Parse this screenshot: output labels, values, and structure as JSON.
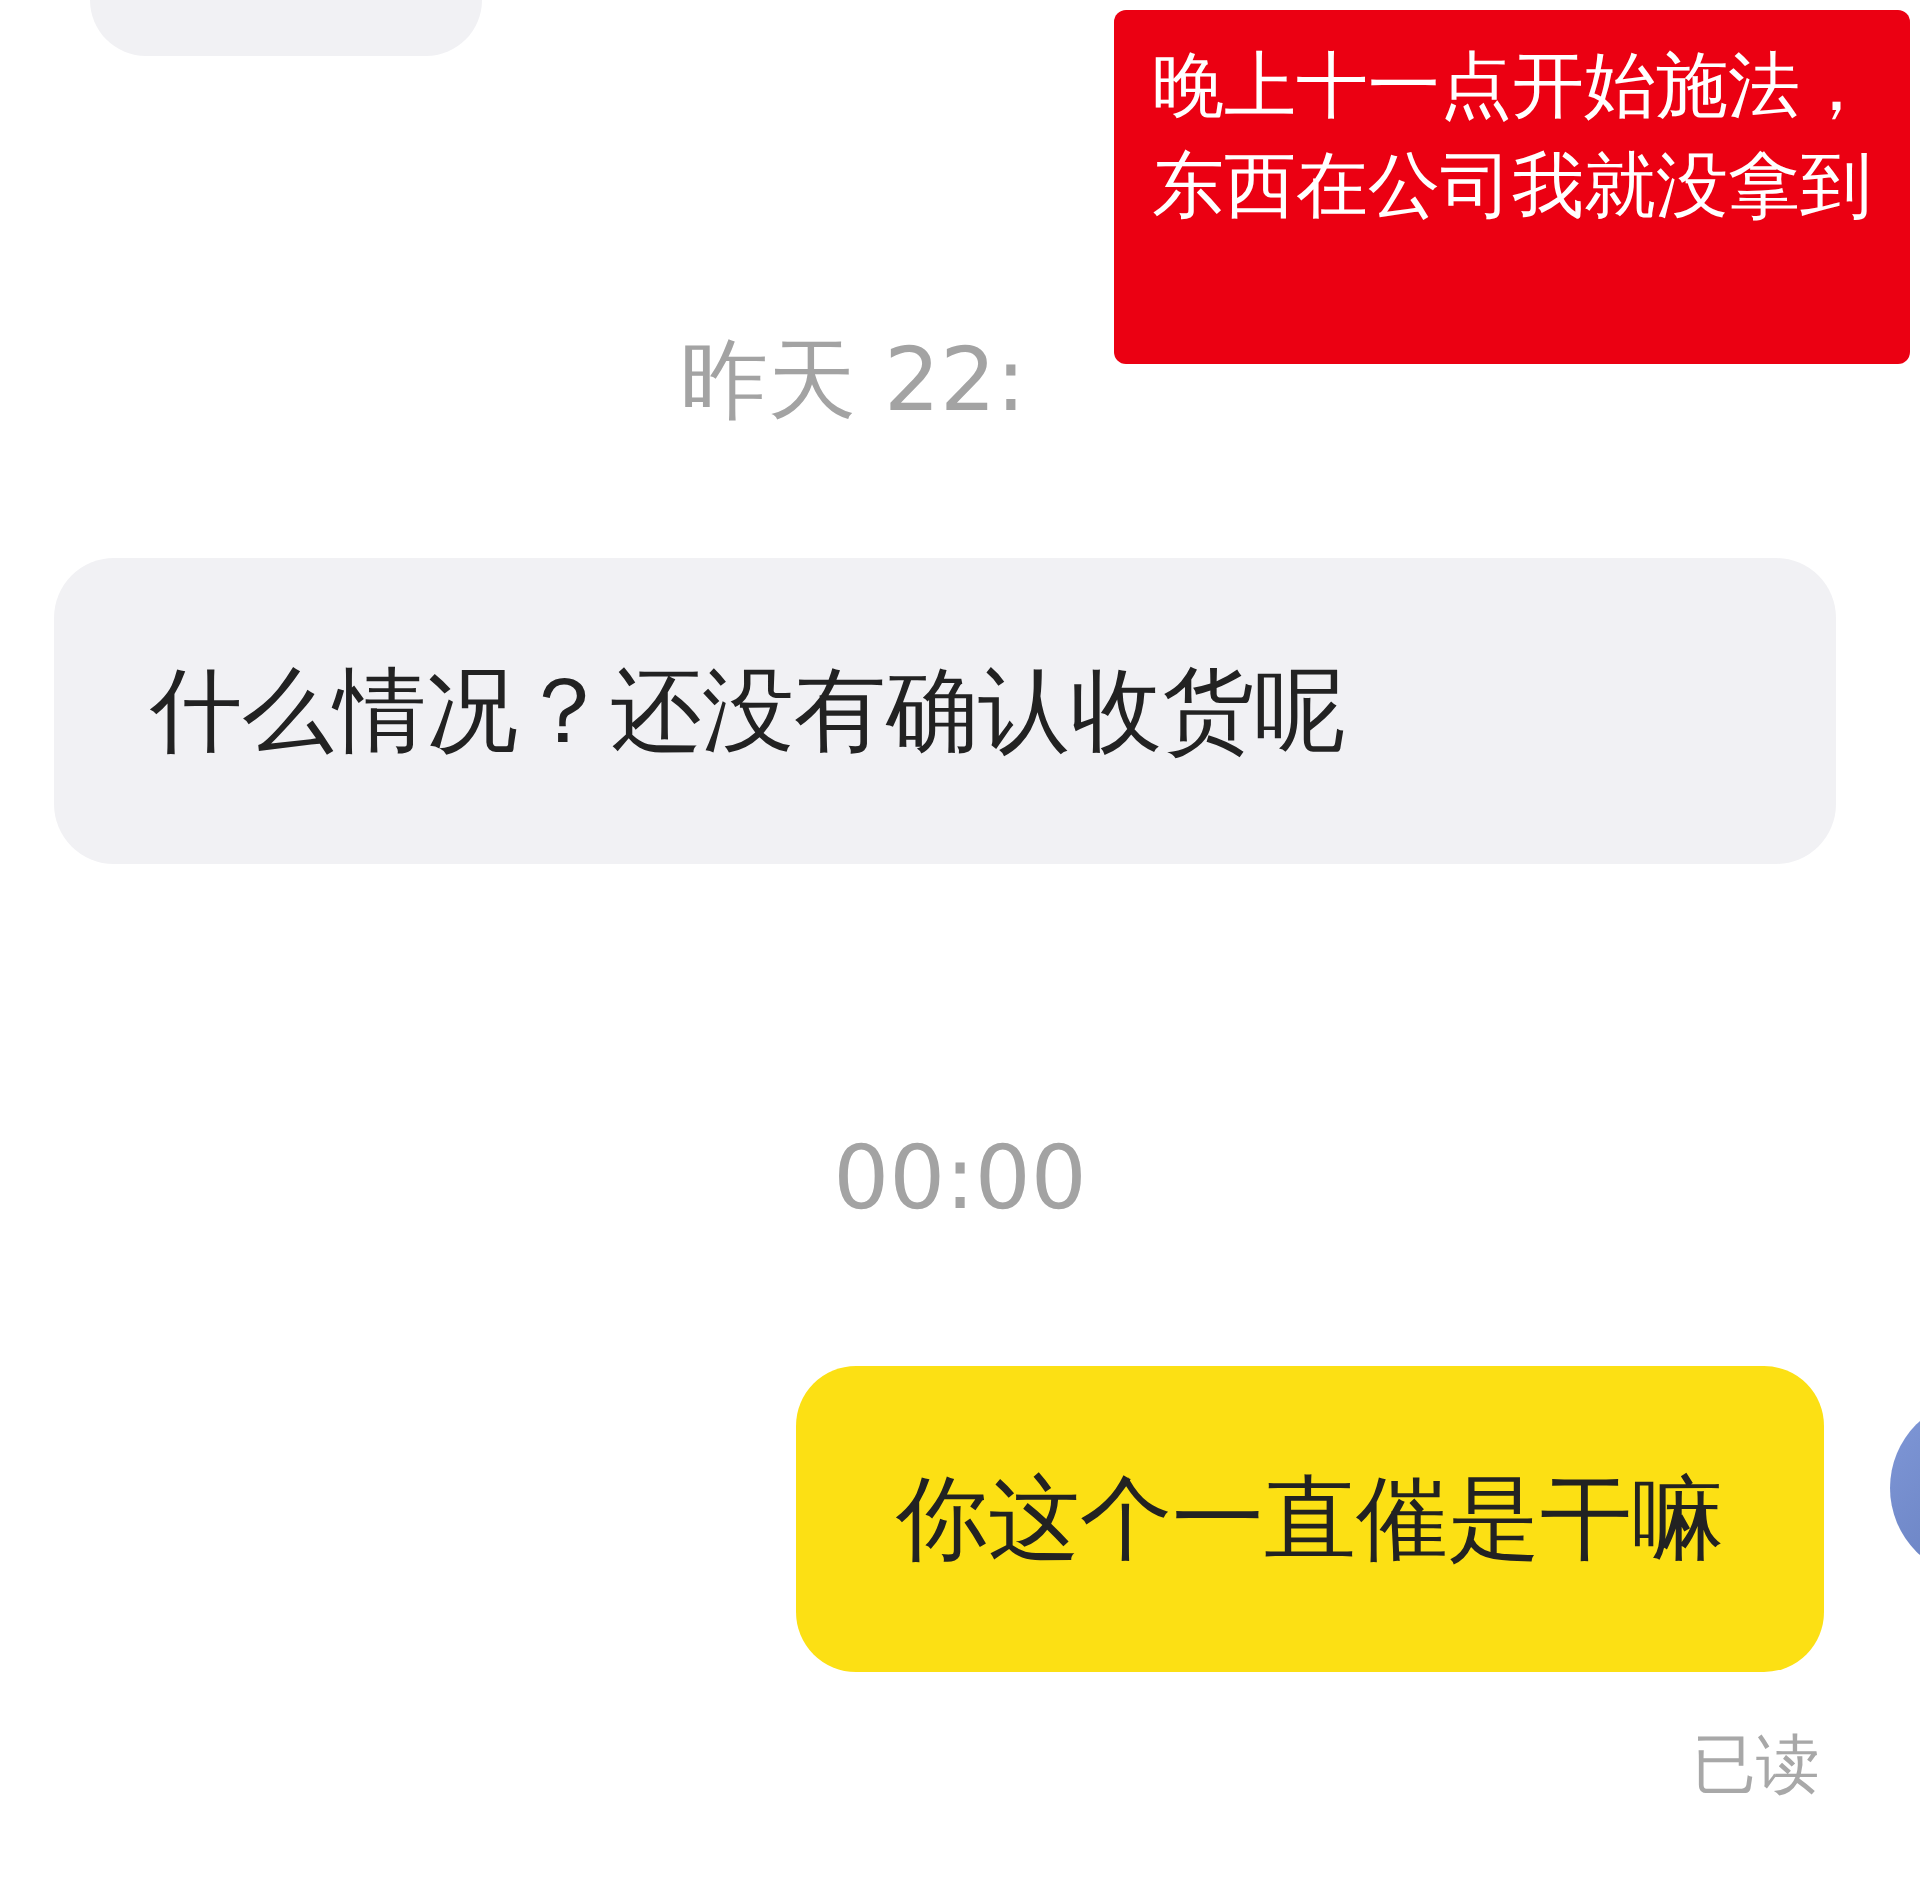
{
  "messages": [
    {
      "kind": "incoming_cut"
    },
    {
      "kind": "time",
      "text": "昨天 22:"
    },
    {
      "kind": "incoming",
      "text": "什么情况？还没有确认收货呢"
    },
    {
      "kind": "time",
      "text": "00:00"
    },
    {
      "kind": "outgoing",
      "text": "你这个一直催是干嘛",
      "status": "已读"
    }
  ],
  "note": {
    "text": "晚上十一点开始施法，东西在公司我就没拿到"
  }
}
